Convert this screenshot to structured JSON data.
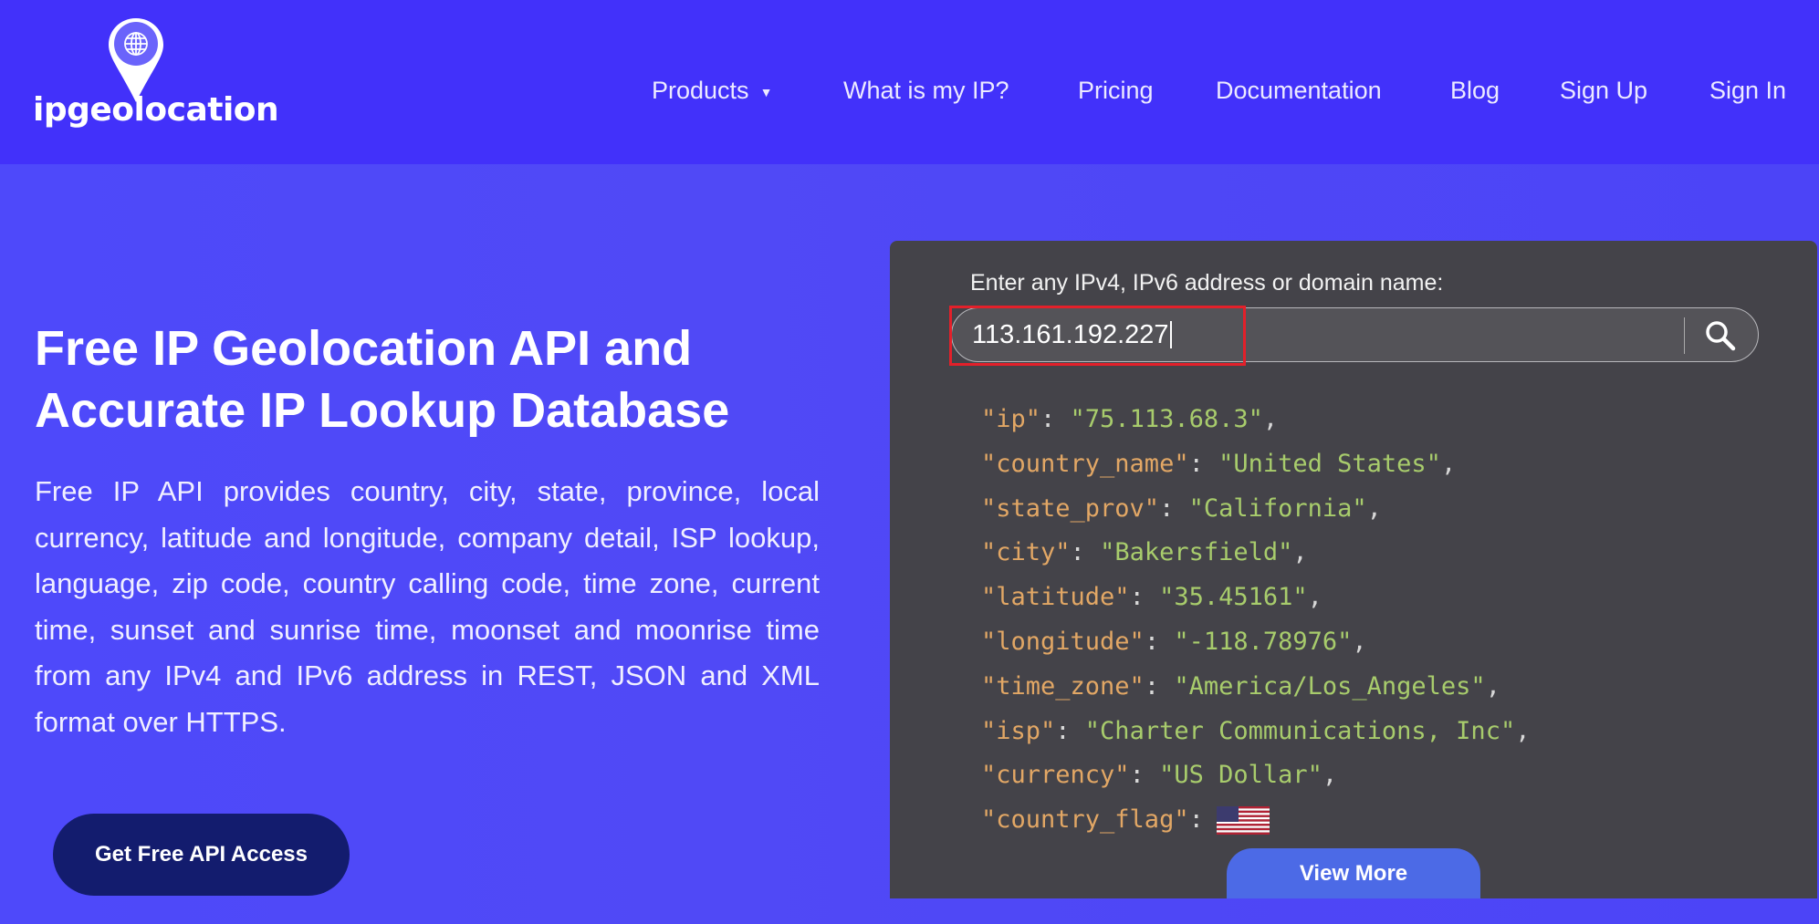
{
  "header": {
    "logo_text": "ipgeolocation",
    "nav": [
      {
        "label": "Products",
        "has_dropdown": true
      },
      {
        "label": "What is my IP?"
      },
      {
        "label": "Pricing"
      },
      {
        "label": "Documentation"
      },
      {
        "label": "Blog"
      },
      {
        "label": "Sign Up"
      },
      {
        "label": "Sign In"
      }
    ]
  },
  "hero": {
    "title_line1": "Free IP Geolocation API and",
    "title_line2": "Accurate IP Lookup Database",
    "description": "Free IP API provides country, city, state, province, local currency, latitude and longitude, company detail, ISP lookup, language, zip code, country calling code, time zone, current time, sunset and sunrise time, moonset and moonrise time from any IPv4 and IPv6 address in REST, JSON and XML format over HTTPS.",
    "cta_label": "Get Free API Access"
  },
  "lookup": {
    "label": "Enter any IPv4, IPv6 address or domain name:",
    "input_value": "113.161.192.227",
    "search_icon": "search-icon",
    "highlight_color": "#e3202a",
    "result": [
      [
        "ip",
        "75.113.68.3"
      ],
      [
        "country_name",
        "United States"
      ],
      [
        "state_prov",
        "California"
      ],
      [
        "city",
        "Bakersfield"
      ],
      [
        "latitude",
        "35.45161"
      ],
      [
        "longitude",
        "-118.78976"
      ],
      [
        "time_zone",
        "America/Los_Angeles"
      ],
      [
        "isp",
        "Charter Communications, Inc"
      ],
      [
        "currency",
        "US Dollar"
      ]
    ],
    "flag_key": "country_flag",
    "flag_icon": "us-flag-icon",
    "view_more_label": "View More"
  },
  "colors": {
    "header": "#4231fa",
    "hero": "#4d47fb",
    "panel": "#444349",
    "cta": "#131c6e",
    "view_more": "#4c6ae6",
    "json_key": "#e2a765",
    "json_value": "#a8cc6c"
  }
}
